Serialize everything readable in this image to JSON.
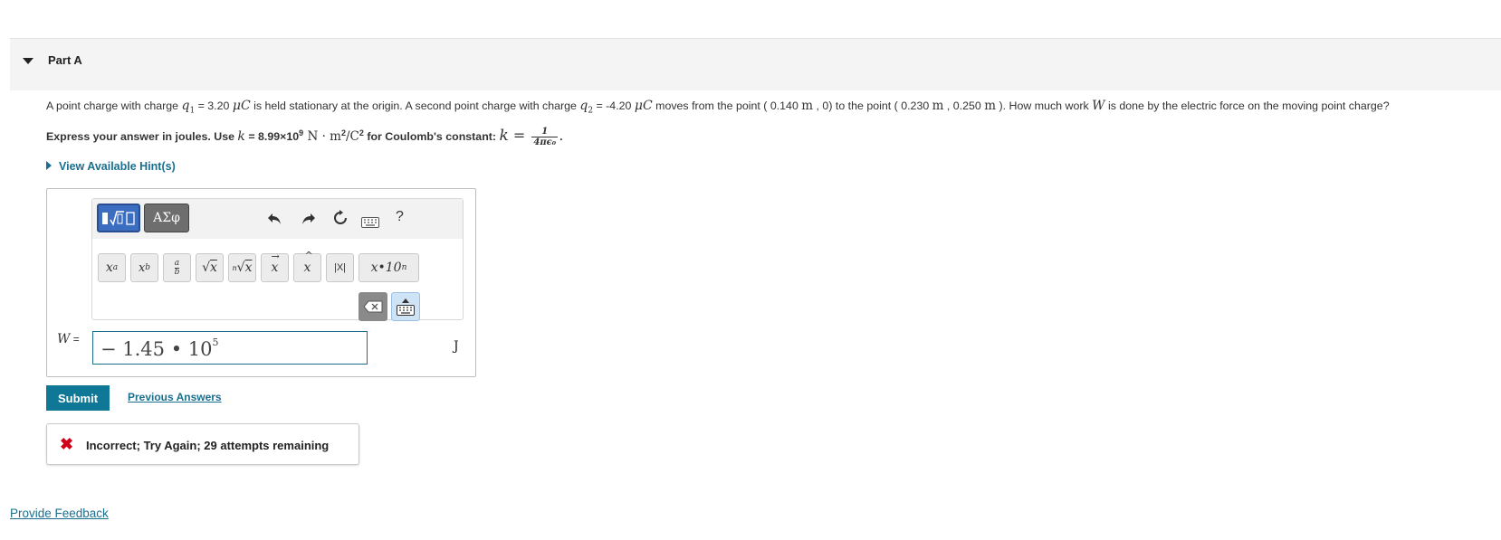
{
  "part": {
    "title": "Part A"
  },
  "problem": {
    "t1": "A point charge with charge ",
    "q1_sym": "q",
    "q1_sub": "1",
    "t2": " = 3.20 ",
    "unit_uC": "μC",
    "t3": " is held stationary at the origin. A second point charge with charge ",
    "q2_sym": "q",
    "q2_sub": "2",
    "t4": " = -4.20 ",
    "t5": " moves from the point ( 0.140 ",
    "m1": "m",
    "t6": " , 0) to the point ( 0.230 ",
    "m2": "m",
    "t7": " , 0.250 ",
    "m3": "m",
    "t8": " ). How much work ",
    "w_sym": "W",
    "t9": " is done by the electric force on the moving point charge?"
  },
  "instruction": {
    "t1": "Express your answer in joules. Use ",
    "k_sym": "k",
    "t2": " = 8.99×10",
    "exp9": "9",
    "units": " N · m",
    "sq1": "2",
    "units2": "/C",
    "sq2": "2",
    "t3": " for Coulomb's constant: ",
    "k_sym2": "k",
    "eq": " = ",
    "frac_num": "1",
    "frac_den": "4πϵ₀",
    "end": "."
  },
  "hint": {
    "label": "View Available Hint(s)"
  },
  "toolbar": {
    "greek_label": "ΑΣφ",
    "help_label": "?",
    "buttons": {
      "sup": "xᵃ",
      "sub": "x_b",
      "abs": "|X|",
      "sci": "x•10ⁿ"
    }
  },
  "answer": {
    "variable": "W",
    "equals": " =",
    "value": "− 1.45 • 10",
    "exponent": "5",
    "unit": "J"
  },
  "actions": {
    "submit": "Submit",
    "previous": "Previous Answers"
  },
  "feedback": {
    "message": "Incorrect; Try Again; 29 attempts remaining"
  },
  "footer": {
    "link": "Provide Feedback"
  },
  "colors": {
    "accent": "#0f7896",
    "link": "#1a6f8f",
    "error": "#d0021b",
    "mode_active": "#3b6dc0"
  }
}
